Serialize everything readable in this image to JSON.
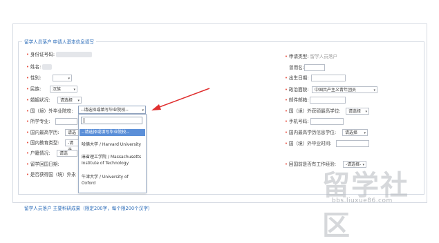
{
  "section_title": "留学人员落户 申请人基本信息填写",
  "section2_title": "留学人员落户 主要科研成果（限定200字，每个限200个汉字）",
  "left_fields": [
    {
      "label": "身份证号码:",
      "required": true
    },
    {
      "label": "姓名:",
      "required": true
    },
    {
      "label": "性别:",
      "required": true
    },
    {
      "label": "民族:",
      "required": true,
      "value": "汉族"
    },
    {
      "label": "婚姻状况:",
      "required": true,
      "value": "请选择"
    },
    {
      "label": "国（境）外毕业院校:",
      "required": true,
      "value": "--请选择或填写毕业院校--"
    },
    {
      "label": "所学专业:",
      "required": true
    },
    {
      "label": "国内最高学历:",
      "required": true,
      "value": "请选"
    },
    {
      "label": "国内教育类型:",
      "required": true,
      "value": "-请选"
    },
    {
      "label": "户籍情况:",
      "required": true,
      "value": "请选"
    },
    {
      "label": "留学回国日期:",
      "required": true
    },
    {
      "label": "是否获得国（境）外永",
      "required": true
    }
  ],
  "right_fields": [
    {
      "label": "申请类型:",
      "required": true,
      "value": "留学人员落户"
    },
    {
      "label": "曾用名:",
      "required": false
    },
    {
      "label": "出生日期:",
      "required": true
    },
    {
      "label": "政治面貌:",
      "required": true,
      "value": "中国共产主义青年团员"
    },
    {
      "label": "邮件邮箱:",
      "required": true
    },
    {
      "label": "国（境）外获硕最高学位:",
      "required": true,
      "value": "请选择"
    },
    {
      "label": "手机号码:",
      "required": true
    },
    {
      "label": "国内最高学历信息学位:",
      "required": true,
      "value": "请选择"
    },
    {
      "label": "国（境）外毕业时间:",
      "required": true
    },
    {
      "label": "回国前是否有工作经验:",
      "required": true,
      "value": "-请选择-"
    }
  ],
  "dropdown": {
    "options": [
      "--请选择或填写毕业院校--",
      "哈佛大学 / Harvard University",
      "麻省理工学院 / Massachusetts Institute of Technology",
      "牛津大学 / University of Oxford"
    ]
  },
  "watermark": {
    "cn": "留学社区",
    "url": "bbs.liuxue86.com"
  },
  "colors": {
    "required_star": "#e84a3a",
    "highlight": "#5b8fd8",
    "arrow": "#e03030",
    "title": "#2a6bb8"
  }
}
